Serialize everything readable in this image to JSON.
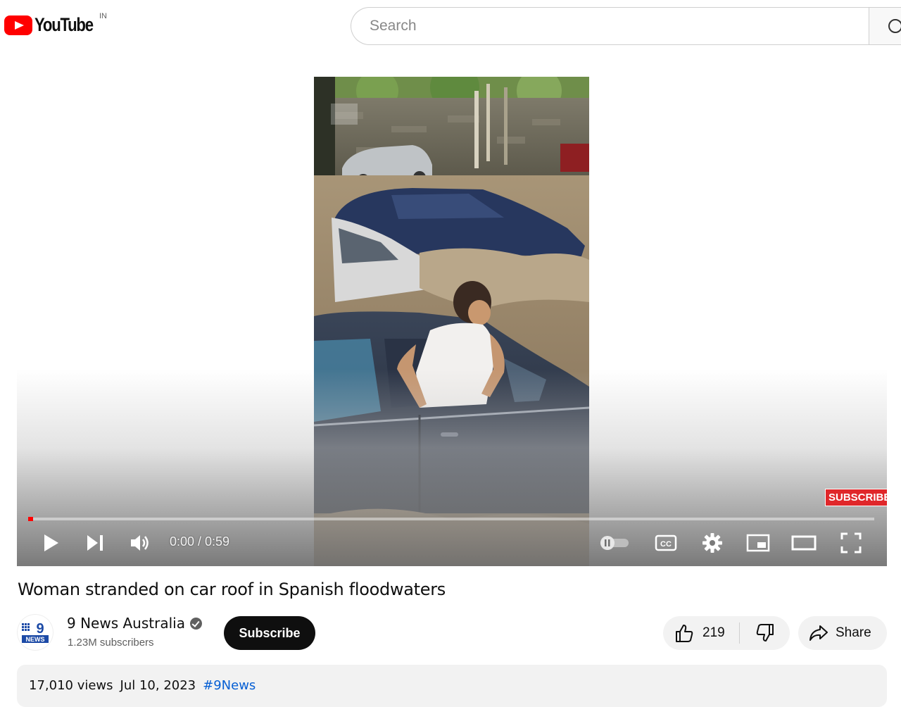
{
  "header": {
    "logo_text": "YouTube",
    "country_code": "IN",
    "search_placeholder": "Search"
  },
  "player": {
    "watermark_label": "SUBSCRIBE",
    "time_display": "0:00 / 0:59",
    "progress_fraction": 0.006,
    "colors": {
      "progress": "#ff0000",
      "watermark": "#e0272a"
    }
  },
  "video": {
    "title": "Woman stranded on car roof in Spanish floodwaters",
    "channel_name": "9 News Australia",
    "subscribers": "1.23M subscribers",
    "subscribe_label": "Subscribe",
    "like_count": "219",
    "share_label": "Share",
    "views": "17,010 views",
    "date": "Jul 10, 2023",
    "hashtag": "#9News"
  }
}
